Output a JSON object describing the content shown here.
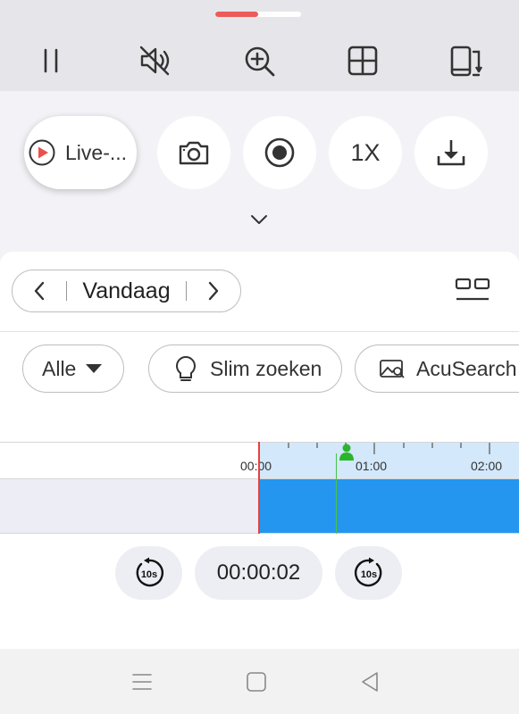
{
  "page_indicator": {
    "active_fraction": 0.5,
    "active_color": "#ec5a5a"
  },
  "toolbar": {
    "icons": [
      "pause-icon",
      "mute-icon",
      "zoom-in-icon",
      "grid-layout-icon",
      "switch-screen-icon"
    ]
  },
  "actions": {
    "live_label": "Live-...",
    "speed_label": "1X",
    "icons": [
      "play-icon",
      "camera-icon",
      "record-icon",
      "download-icon",
      "chevron-down-icon"
    ]
  },
  "date_nav": {
    "label": "Vandaag"
  },
  "filters": {
    "all": "Alle",
    "smart_search": "Slim zoeken",
    "acusearch": "AcuSearch"
  },
  "timeline": {
    "tick_labels": [
      "00:00",
      "01:00",
      "02:00"
    ],
    "recording_color": "#2496f0",
    "playhead_color": "#e8403e",
    "event_color": "#2bb52d"
  },
  "playback": {
    "time": "00:00:02",
    "skip_back_label": "10s",
    "skip_forward_label": "10s"
  },
  "system_nav": {
    "icons": [
      "menu-icon",
      "home-icon",
      "back-icon"
    ]
  }
}
